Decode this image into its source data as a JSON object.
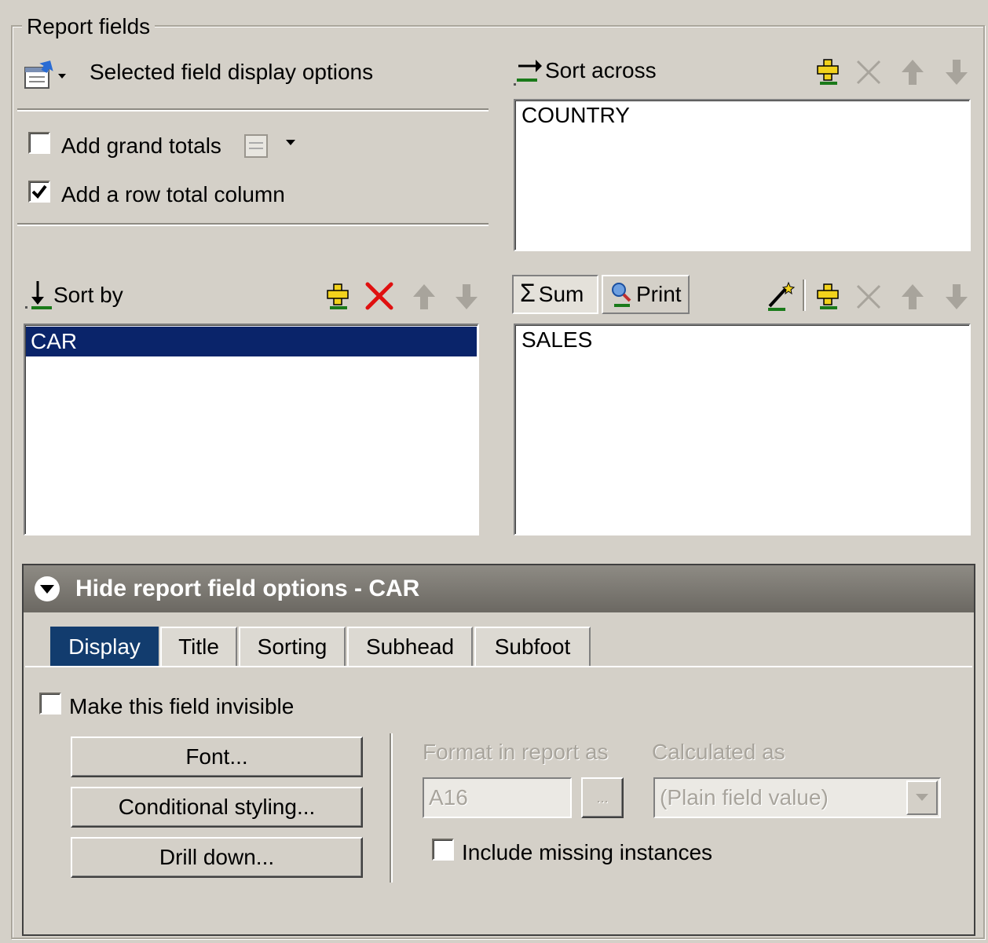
{
  "report_fields": {
    "legend": "Report fields",
    "display_options_label": "Selected field display options",
    "add_grand_totals": {
      "label": "Add grand totals",
      "checked": false
    },
    "add_row_total": {
      "label": "Add a row total column",
      "checked": true
    }
  },
  "sort_across": {
    "label": "Sort across",
    "items": [
      "COUNTRY"
    ]
  },
  "sort_by": {
    "label": "Sort by",
    "items": [
      "CAR"
    ],
    "selected": "CAR"
  },
  "measures": {
    "sum_label": "Sum",
    "print_label": "Print",
    "items": [
      "SALES"
    ]
  },
  "field_options": {
    "header": "Hide report field options - CAR",
    "tabs": [
      "Display",
      "Title",
      "Sorting",
      "Subhead",
      "Subfoot"
    ],
    "active_tab": "Display",
    "invisible": {
      "label": "Make this field invisible",
      "checked": false
    },
    "buttons": {
      "font": "Font...",
      "conditional": "Conditional styling...",
      "drill": "Drill down..."
    },
    "format_label": "Format in report as",
    "format_value": "A16",
    "ellipsis": "...",
    "calculated_label": "Calculated as",
    "calculated_value": "(Plain field value)",
    "missing": {
      "label": "Include missing instances",
      "checked": false
    }
  },
  "colors": {
    "selection": "#0a246a",
    "active_tab": "#123c6e",
    "delete_red": "#e01010",
    "add_green": "#1a7a1a",
    "icon_yellow": "#f2d21c"
  }
}
